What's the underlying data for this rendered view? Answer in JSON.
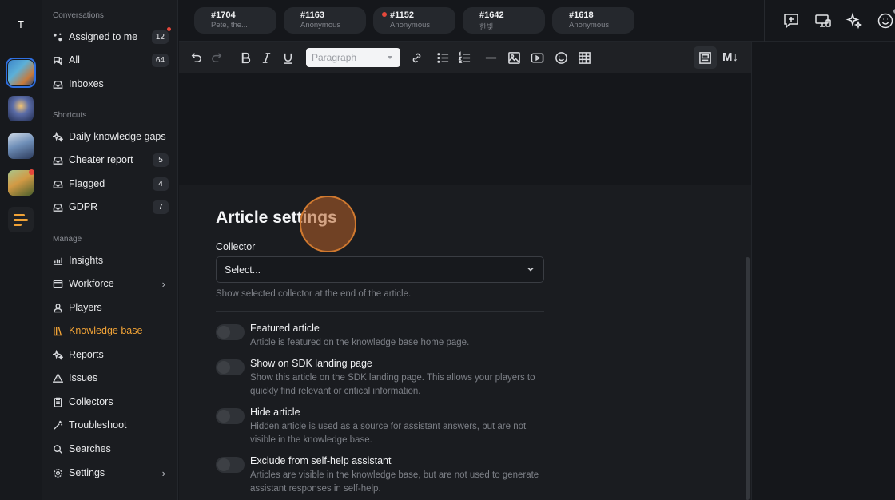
{
  "rail": {
    "avatar_initial": "T",
    "apps": [
      "game-app-1",
      "game-app-2",
      "game-app-3",
      "game-app-4",
      "brand-logo"
    ]
  },
  "sidebar": {
    "sections": {
      "conversations": "Conversations",
      "shortcuts": "Shortcuts",
      "manage": "Manage"
    },
    "conversations": [
      {
        "label": "Assigned to me",
        "count": "12",
        "icon": "assigned-icon"
      },
      {
        "label": "All",
        "count": "64",
        "icon": "chat-icon"
      },
      {
        "label": "Inboxes",
        "count": "",
        "icon": "inbox-icon"
      }
    ],
    "shortcuts": [
      {
        "label": "Daily knowledge gaps",
        "count": "",
        "icon": "sparkle-icon"
      },
      {
        "label": "Cheater report",
        "count": "5",
        "icon": "inbox-icon"
      },
      {
        "label": "Flagged",
        "count": "4",
        "icon": "inbox-icon"
      },
      {
        "label": "GDPR",
        "count": "7",
        "icon": "inbox-icon"
      }
    ],
    "manage": [
      {
        "label": "Insights",
        "icon": "chart-icon"
      },
      {
        "label": "Workforce",
        "icon": "workforce-icon"
      },
      {
        "label": "Players",
        "icon": "players-icon"
      },
      {
        "label": "Knowledge base",
        "icon": "book-icon"
      },
      {
        "label": "Reports",
        "icon": "sparkle-icon"
      },
      {
        "label": "Issues",
        "icon": "warning-icon"
      },
      {
        "label": "Collectors",
        "icon": "clipboard-icon"
      },
      {
        "label": "Troubleshoot",
        "icon": "wand-icon"
      },
      {
        "label": "Searches",
        "icon": "search-icon"
      },
      {
        "label": "Settings",
        "icon": "gear-icon"
      }
    ],
    "accent": "#f0a236"
  },
  "tabs": [
    {
      "num": "#1704",
      "sub": "Pete, the..."
    },
    {
      "num": "#1163",
      "sub": "Anonymous"
    },
    {
      "num": "#1152",
      "sub": "Anonymous"
    },
    {
      "num": "#1642",
      "sub": "한빛"
    },
    {
      "num": "#1618",
      "sub": "Anonymous"
    }
  ],
  "toolbar": {
    "paragraph_label": "Paragraph",
    "markdown_label": "M↓"
  },
  "settings": {
    "title": "Article settings",
    "collector_label": "Collector",
    "collector_value": "Select...",
    "collector_help": "Show selected collector at the end of the article.",
    "toggles": [
      {
        "title": "Featured article",
        "desc": "Article is featured on the knowledge base home page.",
        "on": false
      },
      {
        "title": "Show on SDK landing page",
        "desc": "Show this article on the SDK landing page. This allows your players to quickly find relevant or critical information.",
        "on": false
      },
      {
        "title": "Hide article",
        "desc": "Hidden article is used as a source for assistant answers, but are not visible in the knowledge base.",
        "on": false
      },
      {
        "title": "Exclude from self-help assistant",
        "desc": "Articles are visible in the knowledge base, but are not used to generate assistant responses in self-help.",
        "on": false
      }
    ]
  }
}
